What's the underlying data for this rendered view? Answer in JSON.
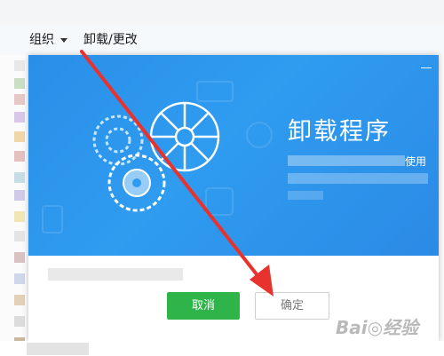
{
  "toolbar": {
    "organize_label": "组织",
    "uninstall_label": "卸载/更改"
  },
  "dialog": {
    "title": "卸载程序",
    "info_suffix": "使用",
    "cancel_label": "取消",
    "ok_label": "确定",
    "colors": {
      "banner": "#2f9cf0",
      "cancel_button": "#2fb44a"
    }
  },
  "icons": [
    "chevron-down-icon",
    "minimize-icon",
    "gear-icon",
    "red-arrow-annotation"
  ]
}
